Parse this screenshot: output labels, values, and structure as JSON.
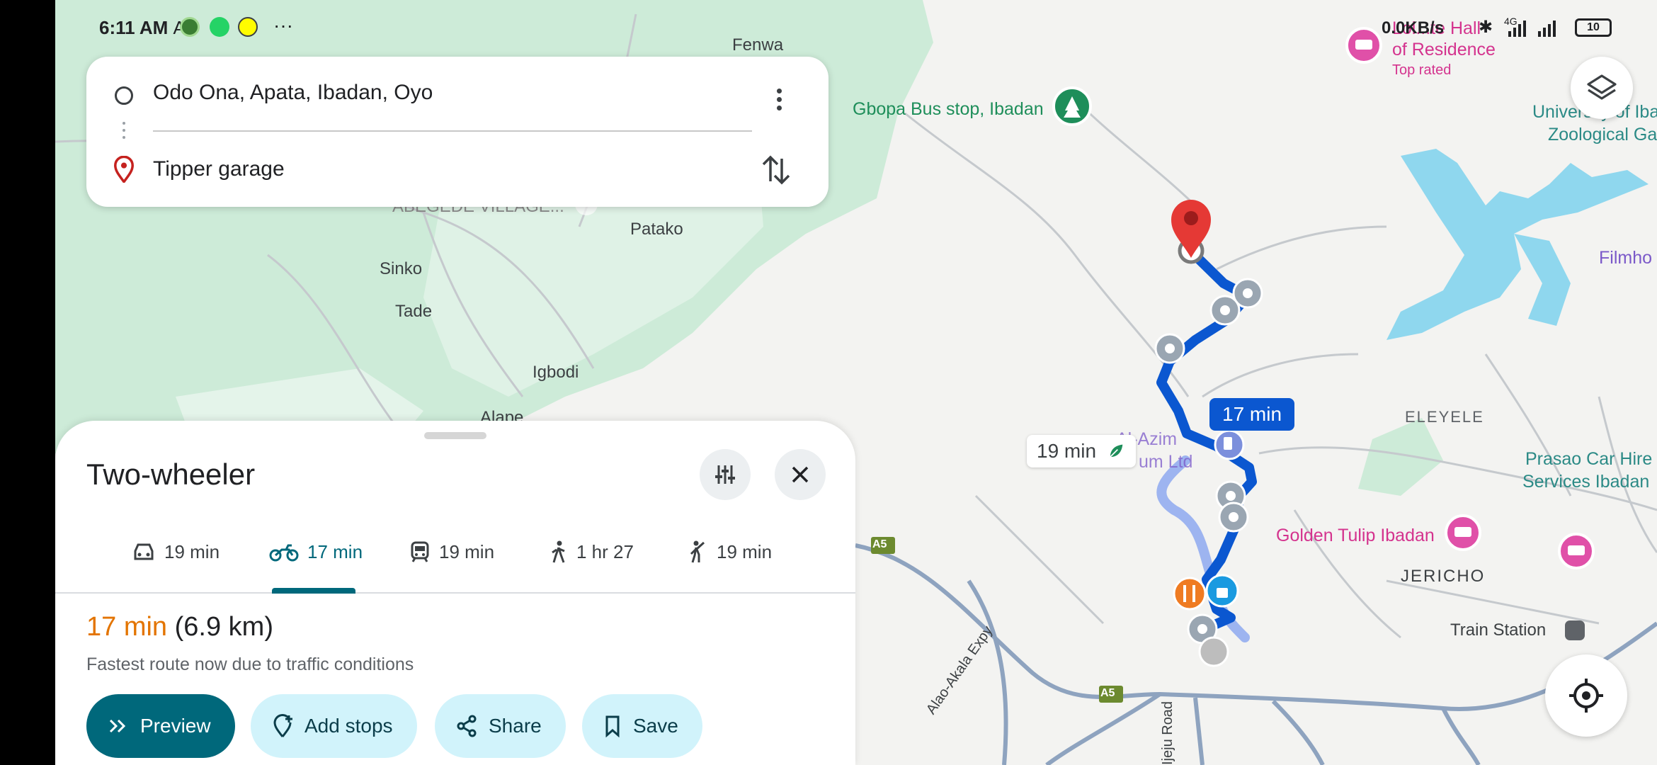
{
  "status_bar": {
    "time": "6:11 AM",
    "time_suffix": "Aw",
    "speed": "0.0KB/s",
    "battery": "10",
    "network": "4G"
  },
  "search": {
    "from": "Odo Ona, Apata, Ibadan, Oyo",
    "to": "Tipper garage"
  },
  "map": {
    "labels": {
      "fenwa": "Fenwa",
      "abegede": "ABEGEDE VILLAGE...",
      "patako": "Patako",
      "sinko": "Sinko",
      "tade": "Tade",
      "igbodi": "Igbodi",
      "alape": "Alape",
      "gbopa": "Gbopa Bus stop, Ibadan",
      "hall": "Lol...te Hall",
      "residence": "of Residence",
      "top_rated": "Top rated",
      "univ1": "University of Iba",
      "univ2": "Zoological Ga",
      "filmho": "Filmho",
      "eleyele": "ELEYELE",
      "azim1": "Al-Azim",
      "azim2": "um Ltd",
      "prasao1": "Prasao Car Hire",
      "prasao2": "Services Ibadan",
      "golden_tulip": "Golden Tulip Ibadan",
      "jericho": "JERICHO",
      "train_station": "Train Station",
      "a5_left": "A5",
      "a5_bottom": "A5",
      "alao": "Alao-Akala Expy",
      "road": "Ijeju Road"
    },
    "primary_time": "17 min",
    "alt_time": "19 min"
  },
  "sheet": {
    "title": "Two-wheeler",
    "modes": [
      {
        "label": "19 min",
        "icon": "car-icon"
      },
      {
        "label": "17 min",
        "icon": "motorcycle-icon"
      },
      {
        "label": "19 min",
        "icon": "transit-icon"
      },
      {
        "label": "1 hr 27",
        "icon": "walk-icon"
      },
      {
        "label": "19 min",
        "icon": "ride-hail-icon"
      }
    ],
    "summary_duration": "17 min",
    "summary_distance": "(6.9 km)",
    "note": "Fastest route now due to traffic conditions",
    "actions": {
      "preview": "Preview",
      "add_stops": "Add stops",
      "share": "Share",
      "save": "Save"
    }
  },
  "colors": {
    "route": "#0b57d0",
    "route_alt": "#9db4f0",
    "accent": "#00687b",
    "duration": "#e37400",
    "water": "#8fd7ee",
    "park": "#c9ead6"
  }
}
